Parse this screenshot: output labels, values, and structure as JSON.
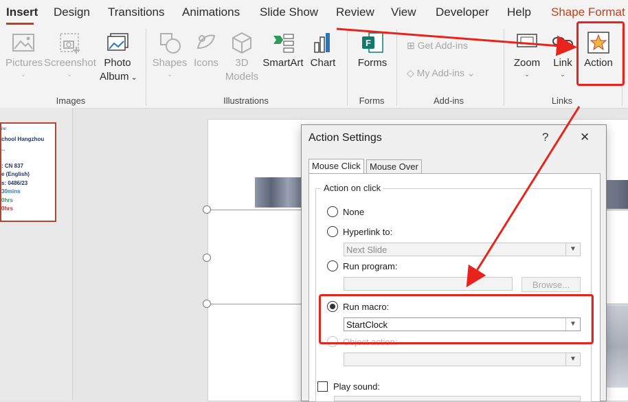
{
  "tabs": [
    "Insert",
    "Design",
    "Transitions",
    "Animations",
    "Slide Show",
    "Review",
    "View",
    "Developer",
    "Help",
    "Shape Format"
  ],
  "ribbon": {
    "images": {
      "label": "Images",
      "pictures": "Pictures",
      "screenshot": "Screenshot",
      "photo_album_1": "Photo",
      "photo_album_2": "Album"
    },
    "illustrations": {
      "label": "Illustrations",
      "shapes": "Shapes",
      "icons": "Icons",
      "models_1": "3D",
      "models_2": "Models",
      "smartart": "SmartArt",
      "chart": "Chart"
    },
    "forms": {
      "label": "Forms",
      "forms": "Forms"
    },
    "addins": {
      "label": "Add-ins",
      "get": "Get Add-ins",
      "my": "My Add-ins"
    },
    "links": {
      "label": "Links",
      "zoom": "Zoom",
      "link": "Link",
      "action": "Action"
    }
  },
  "thumbnail": {
    "lines": [
      "ne:",
      "chool Hangzhou",
      "--",
      ": CN 837",
      "e (English)",
      "s: 0486/23",
      "30mins",
      "0hrs",
      "0hrs"
    ]
  },
  "dialog": {
    "title": "Action Settings",
    "help": "?",
    "close": "✕",
    "tab_click": "Mouse Click",
    "tab_over": "Mouse Over",
    "group_title": "Action on click",
    "none": "None",
    "hyperlink": "Hyperlink to:",
    "hyperlink_value": "Next Slide",
    "run_program": "Run program:",
    "browse": "Browse...",
    "run_macro": "Run macro:",
    "macro_value": "StartClock",
    "object_action": "Object action:",
    "play_sound": "Play sound:"
  },
  "colors": {
    "accent": "#c43e1c",
    "annotation": "#e8231b"
  }
}
